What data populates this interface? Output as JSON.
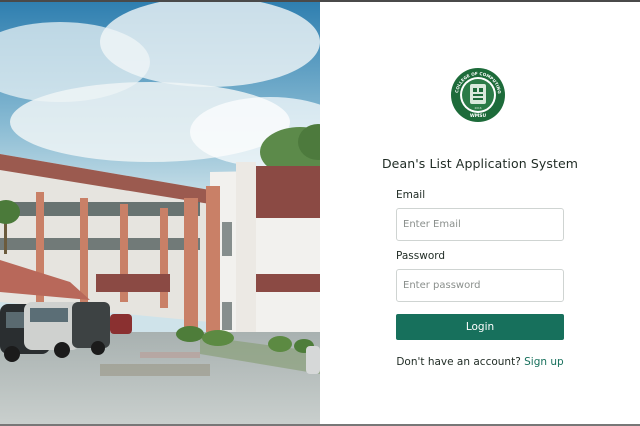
{
  "hero": {
    "image_name": "campus-building-photo"
  },
  "logo": {
    "ring_text": "COLLEGE OF COMPUTING STUDIES",
    "bottom_text": "WMSU",
    "year": "2016",
    "color": "#1d6b3a"
  },
  "login": {
    "title": "Dean's List Application System",
    "email_label": "Email",
    "email_placeholder": "Enter Email",
    "email_value": "",
    "password_label": "Password",
    "password_placeholder": "Enter password",
    "password_value": "",
    "login_button": "Login",
    "no_account_text": "Don't have an account?",
    "signup_link": "Sign up"
  },
  "colors": {
    "accent": "#17705c",
    "text": "#1f2b24"
  }
}
